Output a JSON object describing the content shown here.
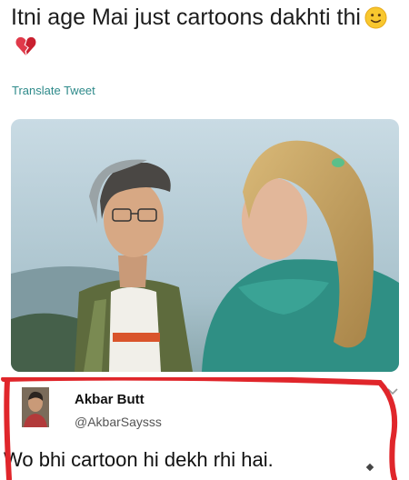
{
  "tweet": {
    "text": "Itni age Mai just cartoons dakhti thi",
    "emojis": [
      "slightly-smiling-face-emoji",
      "broken-heart-emoji"
    ],
    "translate_label": "Translate Tweet"
  },
  "reply": {
    "display_name": "Akbar Butt",
    "handle": "@AkbarSaysss",
    "text": "Wo bhi cartoon hi dekh rhi hai."
  },
  "colors": {
    "translate_link": "#2e8a8a",
    "highlight_scribble": "#e0262b"
  }
}
